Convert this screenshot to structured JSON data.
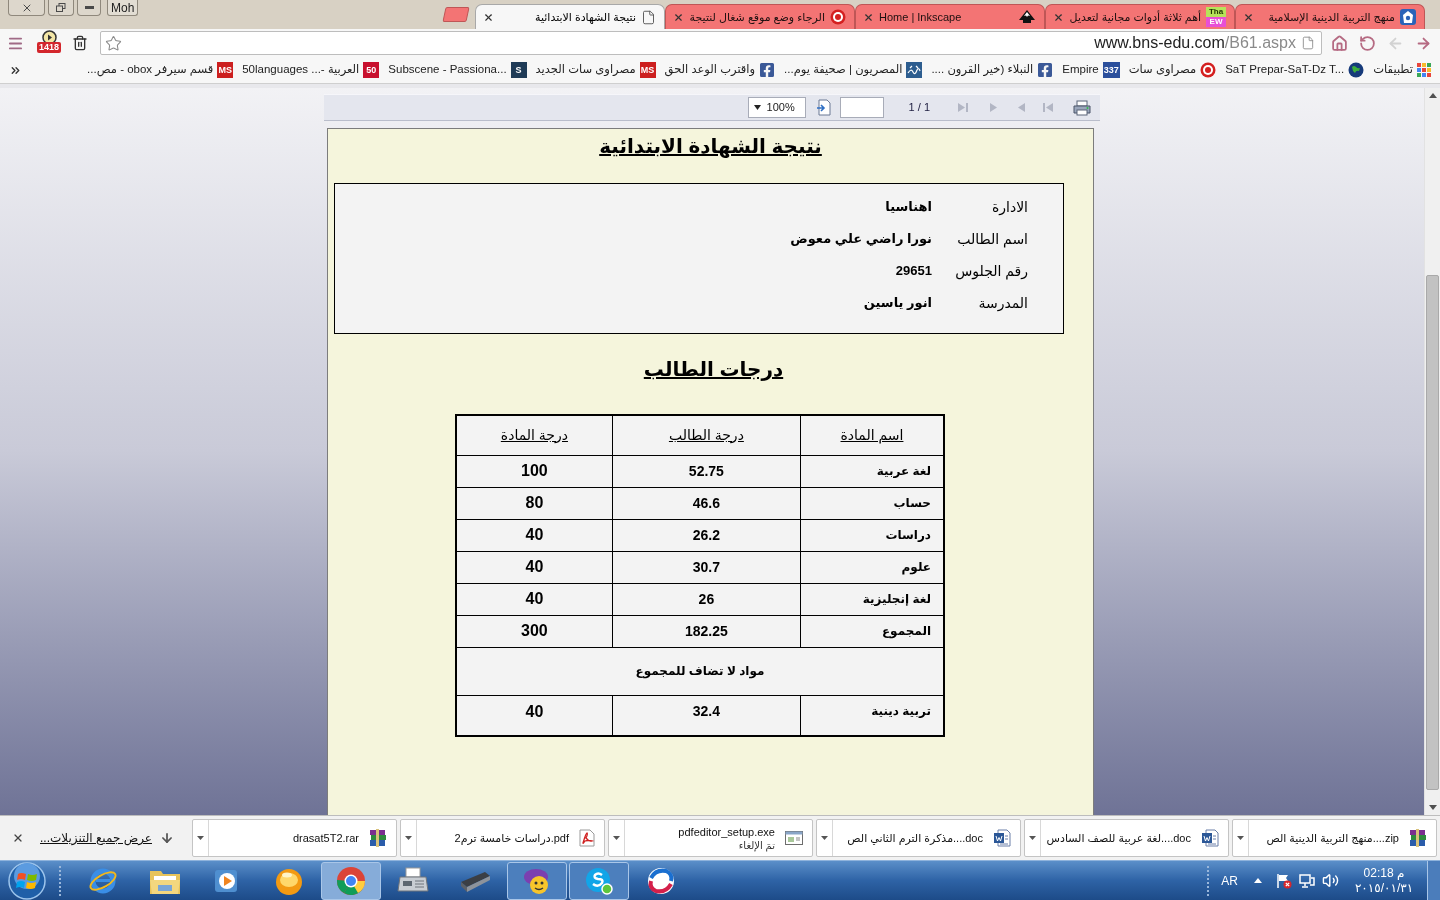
{
  "window": {
    "profile": "Moh"
  },
  "tabs": [
    {
      "kind": "emblem",
      "title": "منهج التربية الدينية الإسلامية",
      "selected": false
    },
    {
      "kind": "tile",
      "tile_text": [
        "Tha",
        "EW"
      ],
      "title": "أهم ثلاثة أدوات مجانية لتعديل",
      "selected": false
    },
    {
      "kind": "peak",
      "title": "Home | Inkscape",
      "selected": false
    },
    {
      "kind": "seal",
      "title": "الرجاء وضع موقع شغال لنتيجة",
      "selected": false
    },
    {
      "kind": "page",
      "title": "نتيجة الشهادة الابتدائية",
      "selected": true
    }
  ],
  "toolbar": {
    "extension_count": "1418",
    "url_host": "www.bns-edu.com",
    "url_path": "/B61.aspx",
    "back": {
      "disabled": false
    },
    "forward": {
      "disabled": true
    }
  },
  "bookmarks": [
    {
      "kind": "apps",
      "title": "تطبيقات"
    },
    {
      "kind": "globe",
      "title": "SaT Prepar-SaT-Dz T..."
    },
    {
      "kind": "seal",
      "title": "مصراوى سات"
    },
    {
      "kind": "badge",
      "badge": "337",
      "color": "#2b4f9c",
      "title": "Empire"
    },
    {
      "kind": "facebook",
      "title": "النبلاء (خير القرون ...."
    },
    {
      "kind": "calligraphy",
      "title": "المصريون | صحيفة يوم..."
    },
    {
      "kind": "facebook",
      "title": "واقترب الوعد الحق"
    },
    {
      "kind": "badge",
      "badge": "MS",
      "color": "#cc1f1f",
      "title": "مصراوى سات الجديد"
    },
    {
      "kind": "badge",
      "badge": "S",
      "color": "#1f3b57",
      "title": "Subscene - Passiona..."
    },
    {
      "kind": "badge",
      "badge": "50",
      "color": "#c8102e",
      "title": "50languages ...- العربية"
    },
    {
      "kind": "badge",
      "badge": "MS",
      "color": "#cc1f1f",
      "title": "قسم سيرفر obox - مص..."
    }
  ],
  "report_viewer": {
    "zoom": "100%",
    "page_count": "1 / 1",
    "page_navigation": {
      "disabled": true
    }
  },
  "report": {
    "title": "نتيجة الشهادة الابتدائية",
    "info": [
      {
        "label": "الادارة",
        "value": "اهناسيا"
      },
      {
        "label": "اسم الطالب",
        "value": "نورا راضي علي معوض"
      },
      {
        "label": "رقم الجلوس",
        "value": "29651"
      },
      {
        "label": "المدرسة",
        "value": "انور ياسين"
      }
    ],
    "grades_title": "درجات الطالب",
    "table": {
      "columns": [
        "اسم المادة",
        "درجة الطالب",
        "درجة المادة"
      ],
      "rows": [
        {
          "kind": "grade",
          "subject": "لغة عربية",
          "score": "52.75",
          "max": "100"
        },
        {
          "kind": "grade",
          "subject": "حساب",
          "score": "46.6",
          "max": "80"
        },
        {
          "kind": "grade",
          "subject": "دراسات",
          "score": "26.2",
          "max": "40"
        },
        {
          "kind": "grade",
          "subject": "علوم",
          "score": "30.7",
          "max": "40"
        },
        {
          "kind": "grade",
          "subject": "لغة إنجليزية",
          "score": "26",
          "max": "40"
        },
        {
          "kind": "grade",
          "subject": "المجموع",
          "score": "182.25",
          "max": "300"
        },
        {
          "kind": "note",
          "text": "مواد لا تضاف للمجموع"
        },
        {
          "kind": "grade",
          "subject": "تربية دينية",
          "score": "32.4",
          "max": "40"
        }
      ]
    }
  },
  "downloads": {
    "items": [
      {
        "kind": "archive",
        "file": "منهج التربية الدينية الص....zip"
      },
      {
        "kind": "document",
        "file": "لغة عربية للصف السادس....doc"
      },
      {
        "kind": "document",
        "file": "مذكرة الترم الثاني  الص....doc"
      },
      {
        "kind": "program",
        "file": "pdfeditor_setup.exe",
        "status": "تمَ الإلغاء"
      },
      {
        "kind": "pdf",
        "file": "دراسات خامسة ترم2.pdf"
      },
      {
        "kind": "archive",
        "file": "drasat5T2.rar"
      }
    ],
    "show_all": "عرض جميع التنزيلات..."
  },
  "taskbar": {
    "apps": [
      {
        "kind": "ie",
        "open": false,
        "focused": false
      },
      {
        "kind": "folder",
        "open": false,
        "focused": false
      },
      {
        "kind": "media",
        "open": false,
        "focused": false
      },
      {
        "kind": "ball",
        "open": false,
        "focused": false
      },
      {
        "kind": "chrome",
        "open": true,
        "focused": true
      },
      {
        "kind": "fax",
        "open": false,
        "focused": false
      },
      {
        "kind": "scanner",
        "open": false,
        "focused": false
      },
      {
        "kind": "messenger",
        "open": true,
        "focused": false
      },
      {
        "kind": "skype",
        "open": true,
        "focused": false
      },
      {
        "kind": "swirl",
        "open": false,
        "focused": false
      }
    ],
    "language": "AR",
    "time": "02:18 م",
    "date": "٢٠١٥/٠١/٣١"
  }
}
